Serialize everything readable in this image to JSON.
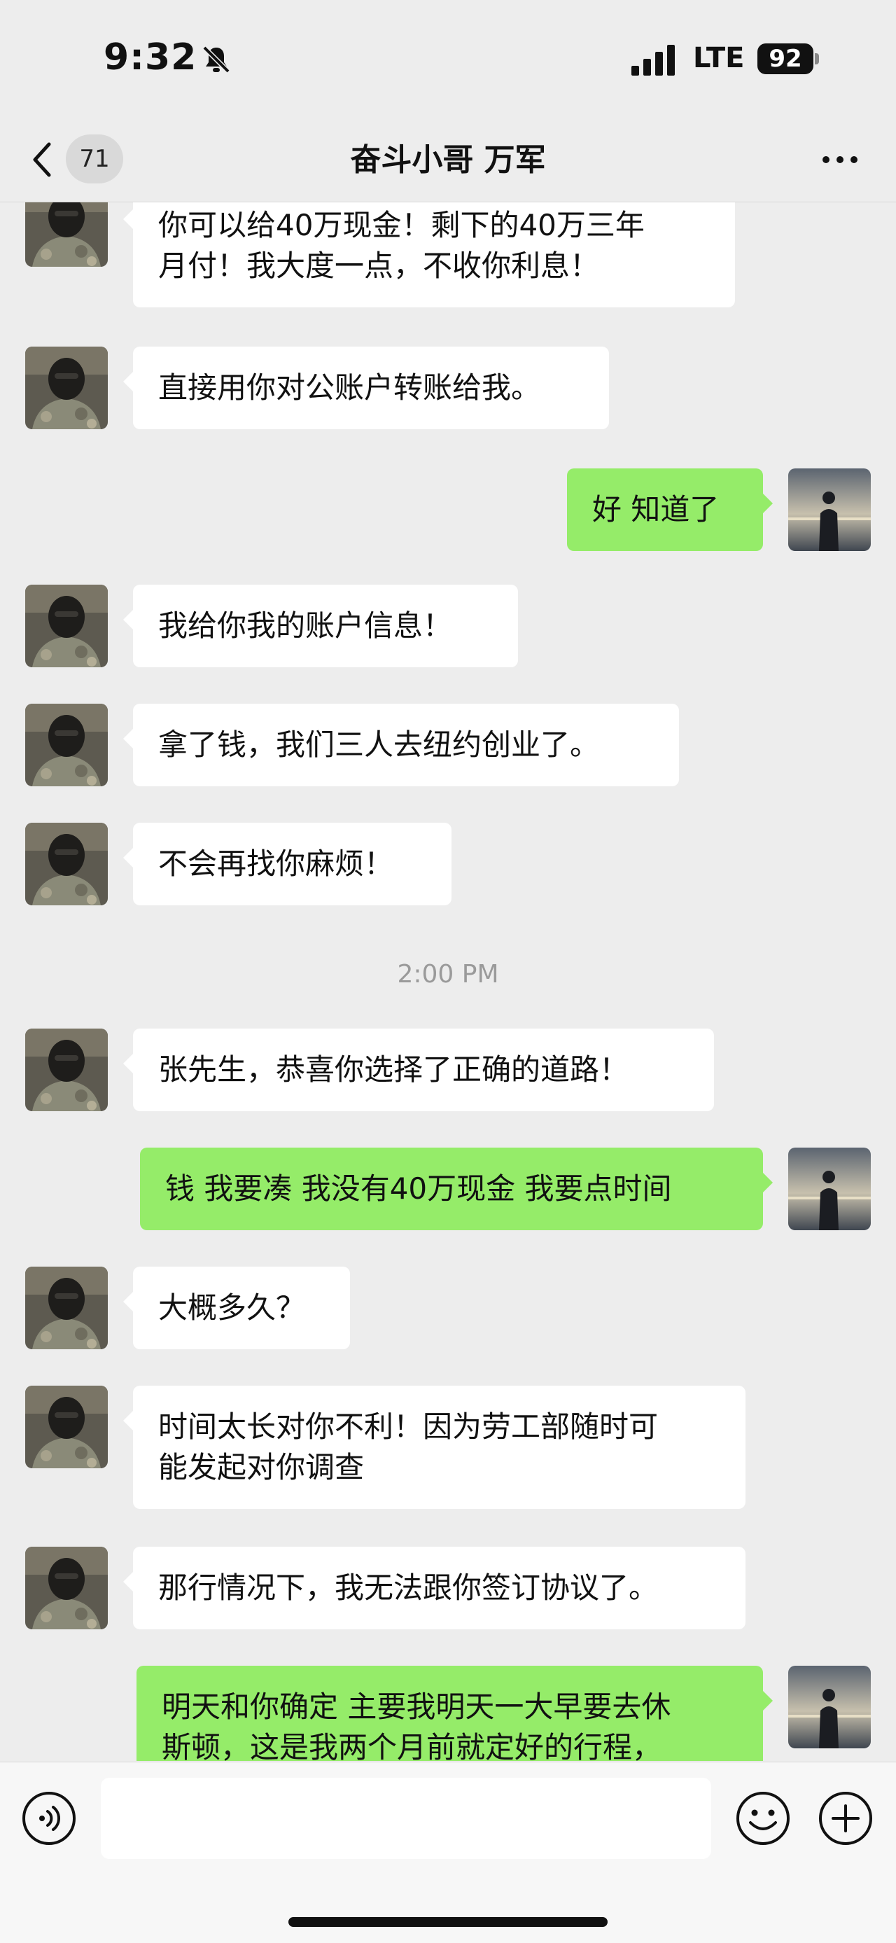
{
  "status_bar": {
    "time": "9:32",
    "network": "LTE",
    "battery": "92",
    "icons": [
      "bell-slash-icon",
      "signal-icon"
    ]
  },
  "nav": {
    "unread_count": "71",
    "title": "奋斗小哥 万军",
    "icons": [
      "chevron-left-icon",
      "more-icon"
    ]
  },
  "messages": [
    {
      "side": "left",
      "lines": [
        "你可以给40万现金！剩下的40万三年",
        "月付！我大度一点，不收你利息！"
      ]
    },
    {
      "side": "left",
      "lines": [
        "直接用你对公账户转账给我。"
      ]
    },
    {
      "side": "right",
      "lines": [
        "好 知道了"
      ]
    },
    {
      "side": "left",
      "lines": [
        "我给你我的账户信息！"
      ]
    },
    {
      "side": "left",
      "lines": [
        "拿了钱，我们三人去纽约创业了。"
      ]
    },
    {
      "side": "left",
      "lines": [
        "不会再找你麻烦！"
      ]
    },
    {
      "timestamp": "2:00 PM"
    },
    {
      "side": "left",
      "lines": [
        "张先生，恭喜你选择了正确的道路！"
      ]
    },
    {
      "side": "right",
      "lines": [
        "钱 我要凑 我没有40万现金 我要点时间"
      ]
    },
    {
      "side": "left",
      "lines": [
        "大概多久？"
      ]
    },
    {
      "side": "left",
      "lines": [
        "时间太长对你不利！因为劳工部随时可",
        "能发起对你调查"
      ]
    },
    {
      "side": "left",
      "lines": [
        "那行情况下，我无法跟你签订协议了。"
      ]
    },
    {
      "side": "right",
      "lines": [
        "明天和你确定 主要我明天一大早要去休",
        "斯顿，这是我两个月前就定好的行程，"
      ]
    }
  ],
  "input": {
    "placeholder": "",
    "icons": [
      "voice-icon",
      "emoji-icon",
      "plus-icon"
    ]
  },
  "colors": {
    "background": "#ededed",
    "bubble_incoming": "#ffffff",
    "bubble_outgoing": "#95ec69",
    "timestamp_text": "#9a9a9a"
  }
}
